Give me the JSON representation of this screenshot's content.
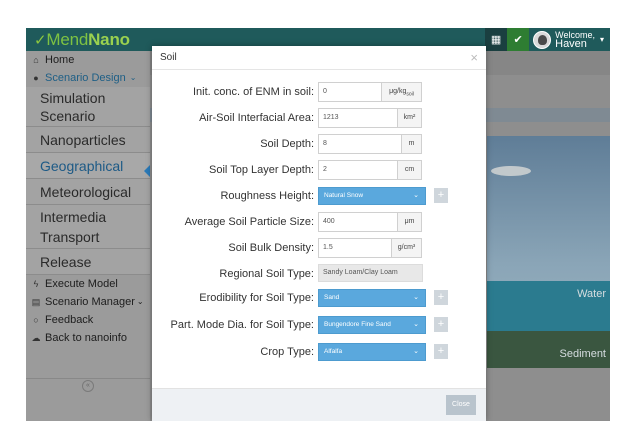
{
  "app": {
    "logo_prefix": "Mend",
    "logo_strong": "Nano",
    "welcome": "Welcome,",
    "user_name": "Haven"
  },
  "sidebar": {
    "home": "Home",
    "scenario_design": "Scenario Design",
    "sub_items": [
      "Simulation Scenario",
      "Nanoparticles",
      "Geographical",
      "Meteorological",
      "Intermedia Transport",
      "Release"
    ],
    "execute_model": "Execute Model",
    "scenario_manager": "Scenario Manager",
    "feedback": "Feedback",
    "back": "Back to nanoinfo"
  },
  "scene": {
    "water": "Water",
    "sediment": "Sediment"
  },
  "modal": {
    "title": "Soil",
    "close_label": "Close",
    "fields": {
      "init_conc": {
        "label": "Init. conc. of ENM in soil:",
        "value": "0",
        "unit": "μg/kg"
      },
      "air_soil": {
        "label": "Air-Soil Interfacial Area:",
        "value": "1213",
        "unit": "km²"
      },
      "soil_depth": {
        "label": "Soil Depth:",
        "value": "8",
        "unit": "m"
      },
      "top_layer": {
        "label": "Soil Top Layer Depth:",
        "value": "2",
        "unit": "cm"
      },
      "roughness": {
        "label": "Roughness Height:",
        "value": "Natural Snow"
      },
      "particle_size": {
        "label": "Average Soil Particle Size:",
        "value": "400",
        "unit": "μm"
      },
      "bulk_density": {
        "label": "Soil Bulk Density:",
        "value": "1.5",
        "unit": "g/cm³"
      },
      "regional_type": {
        "label": "Regional Soil Type:",
        "value": "Sandy Loam/Clay Loam"
      },
      "erodibility": {
        "label": "Erodibility for Soil Type:",
        "value": "Sand"
      },
      "part_mode": {
        "label": "Part. Mode Dia. for Soil Type:",
        "value": "Bungendore Fine Sand"
      },
      "crop_type": {
        "label": "Crop Type:",
        "value": "Alfalfa"
      }
    }
  }
}
